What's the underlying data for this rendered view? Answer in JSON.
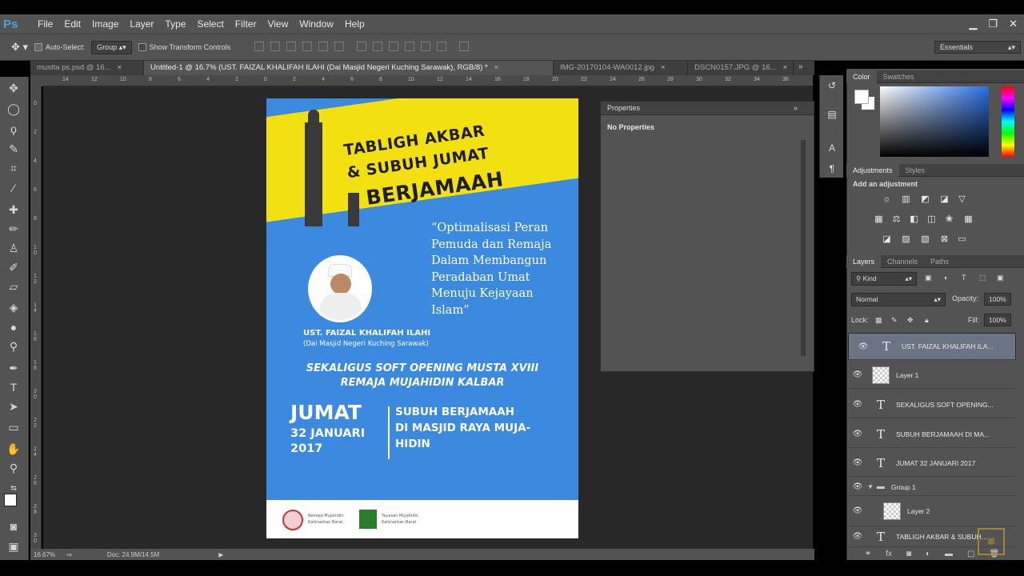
{
  "app": {
    "logo": "Ps"
  },
  "menu": [
    "File",
    "Edit",
    "Image",
    "Layer",
    "Type",
    "Select",
    "Filter",
    "View",
    "Window",
    "Help"
  ],
  "window_controls": [
    "minimize-icon",
    "restore-icon",
    "close-icon"
  ],
  "options": {
    "auto_select_label": "Auto-Select:",
    "auto_select_value": "Group",
    "transform_label": "Show Transform Controls",
    "workspace": "Essentials"
  },
  "tabs": [
    {
      "label": "mustta ps.psd @ 16...",
      "active": false
    },
    {
      "label": "Untitled-1 @ 16.7% (UST. FAIZAL KHALIFAH ILAHI (Dai Masjid Negeri Kuching Sarawak), RGB/8) *",
      "active": true
    },
    {
      "label": "IMG-20170104-WA0012.jpg",
      "active": false
    },
    {
      "label": "DSCN0157.JPG @ 16...",
      "active": false
    }
  ],
  "ruler_h": [
    "14",
    "12",
    "10",
    "8",
    "6",
    "4",
    "2",
    "0",
    "2",
    "4",
    "6",
    "8",
    "10",
    "12",
    "14",
    "16",
    "18",
    "20",
    "22",
    "24",
    "26",
    "28",
    "30",
    "32",
    "34",
    "36"
  ],
  "ruler_v": [
    "0",
    "2",
    "4",
    "6",
    "8",
    "1\n0",
    "1\n2",
    "1\n4",
    "1\n6",
    "1\n8",
    "2\n0",
    "2\n2",
    "2\n4",
    "2\n6",
    "2\n8",
    "3\n0"
  ],
  "status": {
    "zoom": "16.67%",
    "doc": "Doc: 24.9M/14.5M"
  },
  "document": {
    "banner_line1": "TABLIGH AKBAR",
    "banner_line2": "& SUBUH JUMAT",
    "banner_line3": "BERJAMAAH",
    "quote": "“Optimalisasi Peran Pemuda dan Remaja Dalam Membangun Peradaban Umat Menuju Kejayaan Islam”",
    "speaker": "UST. FAIZAL KHALIFAH ILAHI",
    "speaker_sub": "(Dai Masjid Negeri Kuching Sarawak)",
    "opening_line1": "SEKALIGUS SOFT OPENING MUSTA XVIII",
    "opening_line2": "REMAJA MUJAHIDIN KALBAR",
    "day": "JUMAT",
    "date_line1": "32 JANUARI",
    "date_line2": "2017",
    "event_line1": "SUBUH BERJAMAAH",
    "event_line2": "DI MASJID RAYA MUJA-",
    "event_line3": "HIDIN",
    "footer_org1": "Remaja Mujahidin Kalimantan Barat",
    "footer_org2": "Yayasan Mujahidin Kalimantan Barat",
    "colors": {
      "background": "#3b8ae0",
      "banner": "#f2e010"
    }
  },
  "properties": {
    "title": "Properties",
    "body": "No Properties"
  },
  "color_panel": {
    "tabs": [
      "Color",
      "Swatches"
    ]
  },
  "adjustments": {
    "tabs": [
      "Adjustments",
      "Styles"
    ],
    "label": "Add an adjustment"
  },
  "layers_panel": {
    "tabs": [
      "Layers",
      "Channels",
      "Paths"
    ],
    "filter": "Kind",
    "blend_mode": "Normal",
    "opacity_label": "Opacity:",
    "opacity": "100%",
    "lock_label": "Lock:",
    "fill_label": "Fill:",
    "fill": "100%",
    "layers": [
      {
        "type": "text",
        "name": "UST. FAIZAL KHALIFAH ILA...",
        "selected": true
      },
      {
        "type": "pixel",
        "name": "Layer 1",
        "selected": false
      },
      {
        "type": "text",
        "name": "SEKALIGUS SOFT OPENING...",
        "selected": false
      },
      {
        "type": "text",
        "name": "SUBUH BERJAMAAH DI MA...",
        "selected": false
      },
      {
        "type": "text",
        "name": "JUMAT 32 JANUARI 2017",
        "selected": false
      },
      {
        "type": "group",
        "name": "Group 1",
        "selected": false
      },
      {
        "type": "pixel",
        "name": "Layer 2",
        "selected": false
      },
      {
        "type": "text",
        "name": "TABLIGH AKBAR & SUBUH...",
        "selected": false
      }
    ]
  }
}
